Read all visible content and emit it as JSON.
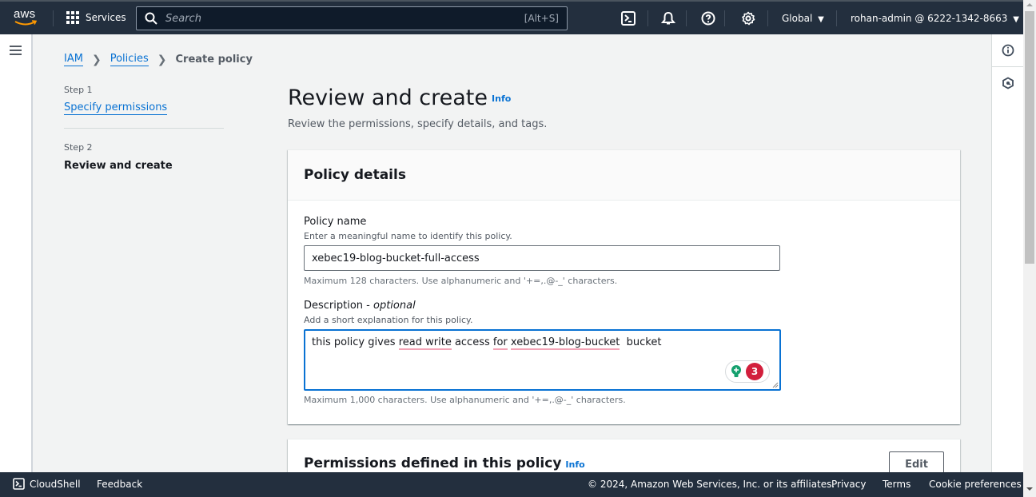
{
  "topnav": {
    "logo": "aws",
    "services_label": "Services",
    "search_placeholder": "Search",
    "search_shortcut": "[Alt+S]",
    "icons": [
      "cloudshell-icon",
      "notifications-icon",
      "help-icon",
      "settings-icon"
    ],
    "region": "Global",
    "account": "rohan-admin @ 6222-1342-8663"
  },
  "breadcrumb": {
    "items": [
      "IAM",
      "Policies"
    ],
    "current": "Create policy"
  },
  "steps": [
    {
      "label": "Step 1",
      "title": "Specify permissions"
    },
    {
      "label": "Step 2",
      "title": "Review and create"
    }
  ],
  "header": {
    "title": "Review and create",
    "info": "Info",
    "description": "Review the permissions, specify details, and tags."
  },
  "policy_details": {
    "title": "Policy details",
    "name_label": "Policy name",
    "name_desc": "Enter a meaningful name to identify this policy.",
    "name_value": "xebec19-blog-bucket-full-access",
    "name_constraint": "Maximum 128 characters. Use alphanumeric and '+=,.@-_' characters.",
    "description_label": "Description - ",
    "description_optional": "optional",
    "description_desc": "Add a short explanation for this policy.",
    "description_value": {
      "part1": "this policy gives ",
      "part2": "read write",
      "part3": " access ",
      "part4": "for",
      "part5": " ",
      "part6": "xebec19-blog-bucket",
      "part7": "  bucket"
    },
    "description_constraint": "Maximum 1,000 characters. Use alphanumeric and '+=,.@-_' characters.",
    "grammar_count": "3"
  },
  "permissions": {
    "title": "Permissions defined in this policy",
    "info": "Info",
    "edit_label": "Edit"
  },
  "footer": {
    "cloudshell": "CloudShell",
    "feedback": "Feedback",
    "copyright": "© 2024, Amazon Web Services, Inc. or its affiliates.",
    "privacy": "Privacy",
    "terms": "Terms",
    "cookies": "Cookie preferences"
  },
  "colors": {
    "nav_bg": "#232f3e",
    "link": "#0972d3",
    "focus": "#0972d3",
    "badge": "#d21f3c"
  }
}
